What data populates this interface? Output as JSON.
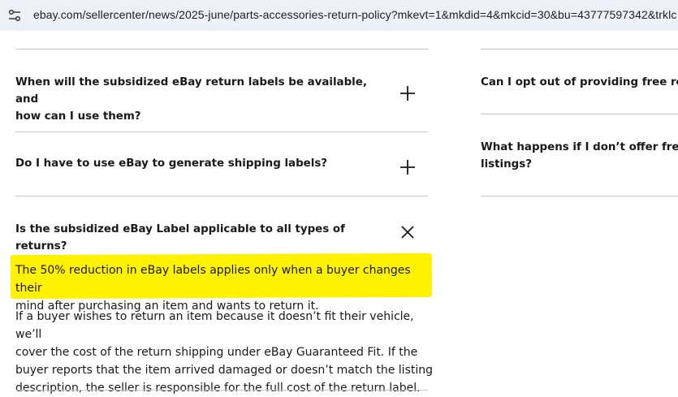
{
  "browser": {
    "url": "ebay.com/sellercenter/news/2025-june/parts-accessories-return-policy?mkevt=1&mkdid=4&mkcid=30&bu=43777597342&trklc",
    "url_icon": "tune-icon"
  },
  "faq_left": {
    "items": [
      {
        "question_line1": "When will the subsidized eBay return labels be available, and",
        "question_line2": "how can I use them?",
        "toggle_icon": "plus-icon"
      },
      {
        "question": "Do I have to use eBay to generate shipping labels?",
        "toggle_icon": "plus-icon"
      },
      {
        "question": "Is the subsidized eBay Label applicable to all types of returns?",
        "toggle_icon": "close-icon",
        "answer_highlighted_line1": "The 50% reduction in eBay labels applies only when a buyer changes their",
        "answer_highlighted_line2": "mind after purchasing an item and wants to return it.",
        "answer_line1": "If a buyer wishes to return an item because it doesn’t fit their vehicle, we’ll",
        "answer_line2": "cover the cost of the return shipping under eBay Guaranteed Fit. If the",
        "answer_line3": "buyer reports that the item arrived damaged or doesn’t match the listing",
        "answer_line4": "description, the seller is responsible for the full cost of the return label."
      }
    ]
  },
  "faq_right": {
    "items": [
      {
        "question": "Can I opt out of providing free retu"
      },
      {
        "question_line1": "What happens if I don’t offer free r",
        "question_line2": "listings?"
      }
    ]
  },
  "colors": {
    "highlight": "#fff200",
    "divider": "#c7c7c7",
    "text": "#191919"
  }
}
